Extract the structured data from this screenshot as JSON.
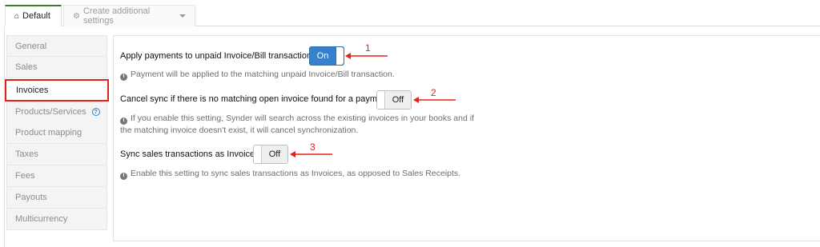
{
  "tabs": [
    {
      "label": "Default",
      "icon": "home-icon",
      "active": true
    },
    {
      "label": "Create additional settings",
      "icon": "gear-icon",
      "active": false
    }
  ],
  "sidebar": {
    "items": [
      {
        "label": "General"
      },
      {
        "label": "Sales"
      },
      {
        "label": "Invoices"
      },
      {
        "label": "Products/Services",
        "help": "?"
      },
      {
        "label": "Product mapping"
      },
      {
        "label": "Taxes"
      },
      {
        "label": "Fees"
      },
      {
        "label": "Payouts"
      },
      {
        "label": "Multicurrency"
      }
    ]
  },
  "settings": [
    {
      "label": "Apply payments to unpaid Invoice/Bill transactions",
      "state": "On",
      "hint_lines": [
        "Payment will be applied to the matching unpaid Invoice/Bill transaction."
      ]
    },
    {
      "label": "Cancel sync if there is no matching open invoice found for a payment",
      "state": "Off",
      "hint_lines": [
        "If you enable this setting, Synder will search across the existing invoices in your books and if",
        "the matching invoice doesn't exist, it will cancel synchronization."
      ]
    },
    {
      "label": "Sync sales transactions as Invoices",
      "state": "Off",
      "hint_lines": [
        "Enable this setting to sync sales transactions as Invoices, as opposed to Sales Receipts."
      ]
    }
  ],
  "annotations": [
    "1",
    "2",
    "3"
  ],
  "colors": {
    "accent_green": "#3a7e2b",
    "toggle_on": "#3680cc",
    "highlight_red": "#e2231a"
  }
}
